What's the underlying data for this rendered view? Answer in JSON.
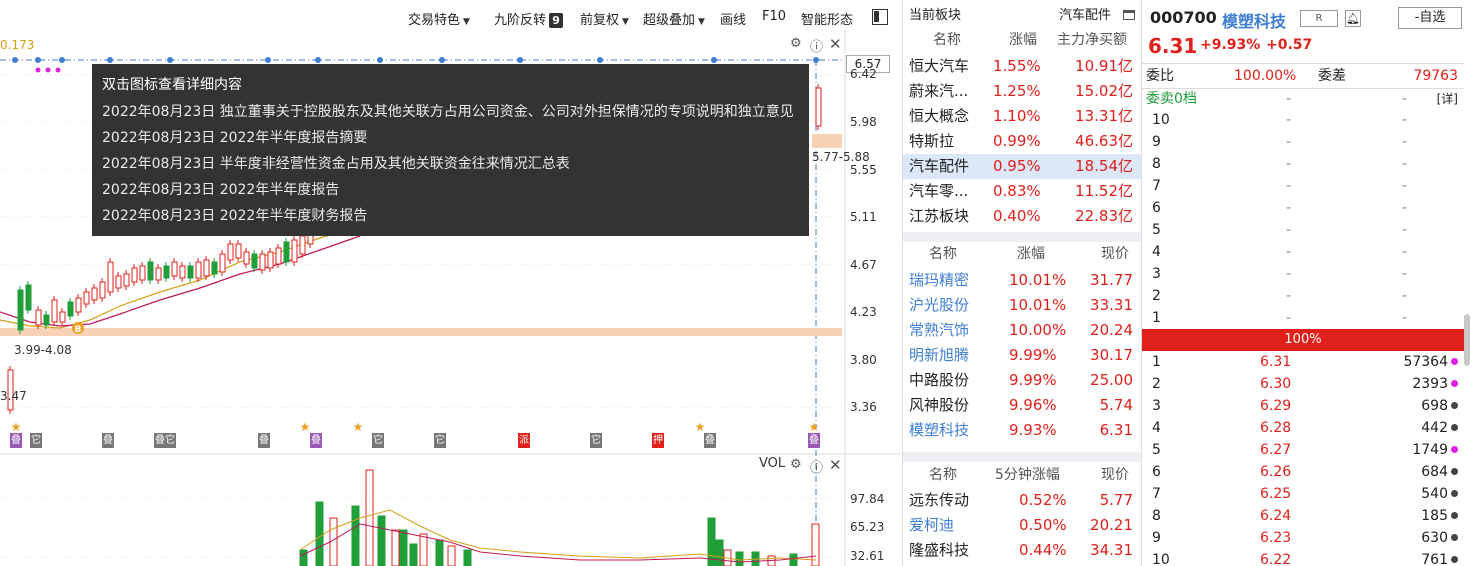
{
  "toolbar": {
    "trade_special": "交易特色",
    "nine_reversal": "九阶反转",
    "nine_badge": "9",
    "pre_adjust": "前复权",
    "super_overlay": "超级叠加",
    "draw_line": "画线",
    "f10": "F10",
    "smart_pattern": "智能形态"
  },
  "chart": {
    "top_left_value": "0.173",
    "price_tag": "6.57",
    "y_ticks": [
      "6.42",
      "5.98",
      "5.55",
      "5.11",
      "4.67",
      "4.23",
      "3.80",
      "3.36"
    ],
    "range_label_right": "5.77-5.88",
    "range_label_left": "3.99-4.08",
    "low_label": "3.47",
    "b_marker": "B",
    "vol_label": "VOL",
    "vol_ticks": [
      "97.84",
      "65.23",
      "32.61"
    ],
    "colors": {
      "up": "#e0201b",
      "down": "#1f9e3a",
      "ma1": "#d4a017",
      "ma2": "#c2185b",
      "band": "#f8d2b5"
    }
  },
  "tooltip": {
    "title": "双击图标查看详细内容",
    "rows": [
      "2022年08月23日 独立董事关于控股股东及其他关联方占用公司资金、公司对外担保情况的专项说明和独立意见",
      "2022年08月23日 2022年半年度报告摘要",
      "2022年08月23日 半年度非经营性资金占用及其他关联资金往来情况汇总表",
      "2022年08月23日 2022年半年度报告",
      "2022年08月23日 2022年半年度财务报告"
    ]
  },
  "event_icons": [
    "叠",
    "它",
    "叠",
    "叠它",
    "叠",
    "叠",
    "它",
    "它",
    "派",
    "它",
    "押",
    "叠",
    "叠"
  ],
  "sector_panel": {
    "title": "当前板块",
    "current": "汽车配件",
    "headers": [
      "名称",
      "涨幅",
      "主力净买额"
    ],
    "rows": [
      {
        "name": "恒大汽车",
        "pct": "1.55%",
        "net": "10.91亿"
      },
      {
        "name": "蔚来汽...",
        "pct": "1.25%",
        "net": "15.02亿"
      },
      {
        "name": "恒大概念",
        "pct": "1.10%",
        "net": "13.31亿"
      },
      {
        "name": "特斯拉",
        "pct": "0.99%",
        "net": "46.63亿"
      },
      {
        "name": "汽车配件",
        "pct": "0.95%",
        "net": "18.54亿"
      },
      {
        "name": "汽车零...",
        "pct": "0.83%",
        "net": "11.52亿"
      },
      {
        "name": "江苏板块",
        "pct": "0.40%",
        "net": "22.83亿"
      }
    ]
  },
  "stock_panel": {
    "headers": [
      "名称",
      "涨幅",
      "现价"
    ],
    "rows": [
      {
        "name": "瑞玛精密",
        "pct": "10.01%",
        "price": "31.77"
      },
      {
        "name": "沪光股份",
        "pct": "10.01%",
        "price": "33.31"
      },
      {
        "name": "常熟汽饰",
        "pct": "10.00%",
        "price": "20.24"
      },
      {
        "name": "明新旭腾",
        "pct": "9.99%",
        "price": "30.17"
      },
      {
        "name": "中路股份",
        "pct": "9.99%",
        "price": "25.00"
      },
      {
        "name": "风神股份",
        "pct": "9.96%",
        "price": "5.74"
      },
      {
        "name": "模塑科技",
        "pct": "9.93%",
        "price": "6.31"
      }
    ]
  },
  "speed_panel": {
    "headers": [
      "名称",
      "5分钟涨幅",
      "现价"
    ],
    "rows": [
      {
        "name": "远东传动",
        "pct": "0.52%",
        "price": "5.77"
      },
      {
        "name": "爱柯迪",
        "pct": "0.50%",
        "price": "20.21"
      },
      {
        "name": "隆盛科技",
        "pct": "0.44%",
        "price": "34.31"
      }
    ]
  },
  "quote": {
    "code": "000700",
    "name": "模塑科技",
    "r_badge": "R",
    "watch_btn": "-自选",
    "price": "6.31",
    "pct": "+9.93%",
    "change": "+0.57",
    "weibi_label": "委比",
    "weibi": "100.00%",
    "weicha_label": "委差",
    "weicha": "79763",
    "sell0_label": "委卖0档",
    "dash": "-",
    "detail": "[详]",
    "sell_levels": [
      "10",
      "9",
      "8",
      "7",
      "6",
      "5",
      "4",
      "3",
      "2",
      "1"
    ],
    "bar_pct": "100%",
    "buy_levels": [
      {
        "lvl": "1",
        "price": "6.31",
        "vol": "57364",
        "dot": "#e020e0"
      },
      {
        "lvl": "2",
        "price": "6.30",
        "vol": "2393",
        "dot": "#e020e0"
      },
      {
        "lvl": "3",
        "price": "6.29",
        "vol": "698",
        "dot": "#444444"
      },
      {
        "lvl": "4",
        "price": "6.28",
        "vol": "442",
        "dot": "#444444"
      },
      {
        "lvl": "5",
        "price": "6.27",
        "vol": "1749",
        "dot": "#e020e0"
      },
      {
        "lvl": "6",
        "price": "6.26",
        "vol": "684",
        "dot": "#444444"
      },
      {
        "lvl": "7",
        "price": "6.25",
        "vol": "540",
        "dot": "#444444"
      },
      {
        "lvl": "8",
        "price": "6.24",
        "vol": "185",
        "dot": "#444444"
      },
      {
        "lvl": "9",
        "price": "6.23",
        "vol": "630",
        "dot": "#444444"
      },
      {
        "lvl": "10",
        "price": "6.22",
        "vol": "761",
        "dot": "#444444"
      }
    ]
  }
}
